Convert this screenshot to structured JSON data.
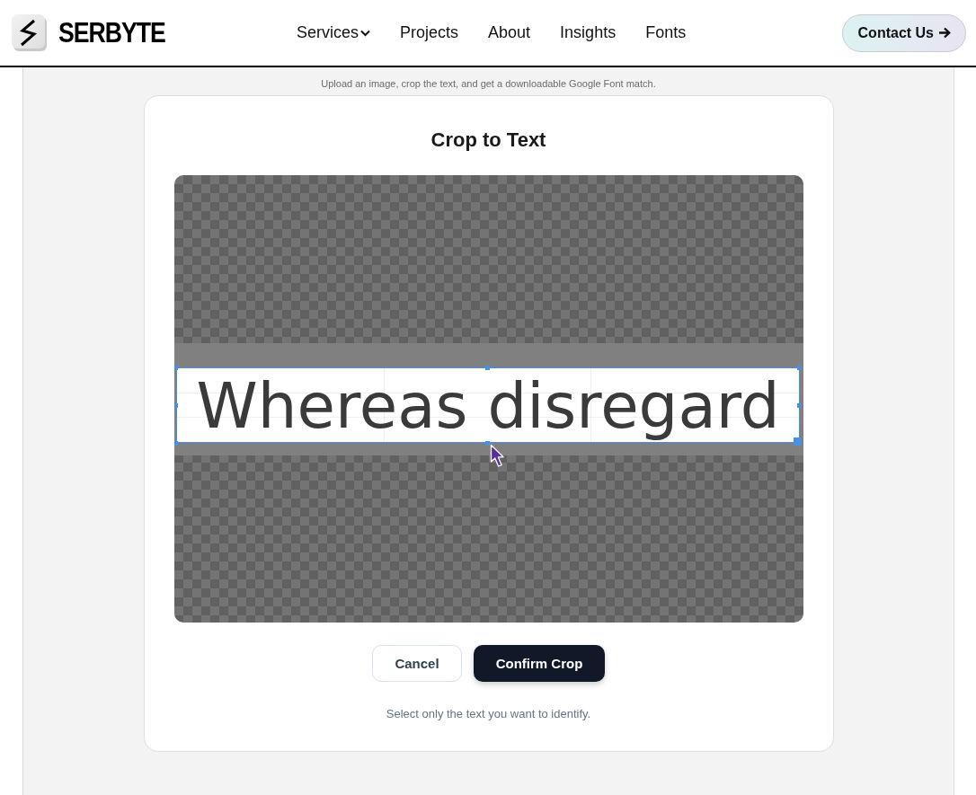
{
  "header": {
    "brand": "SERBYTE",
    "nav": [
      {
        "label": "Services",
        "kind": "dropdown"
      },
      {
        "label": "Projects",
        "kind": "link"
      },
      {
        "label": "About",
        "kind": "link"
      },
      {
        "label": "Insights",
        "kind": "link"
      },
      {
        "label": "Fonts",
        "kind": "link"
      }
    ],
    "contact_button": {
      "label": "Contact Us"
    }
  },
  "page": {
    "subtitle": "Upload an image, crop the text, and get a downloadable Google Font match."
  },
  "crop_dialog": {
    "title": "Crop to Text",
    "image_text": "Whereas disregard",
    "buttons": [
      {
        "label": "Cancel",
        "kind": "secondary"
      },
      {
        "label": "Confirm Crop",
        "kind": "primary"
      }
    ],
    "hint": "Select only the text you want to identify."
  }
}
